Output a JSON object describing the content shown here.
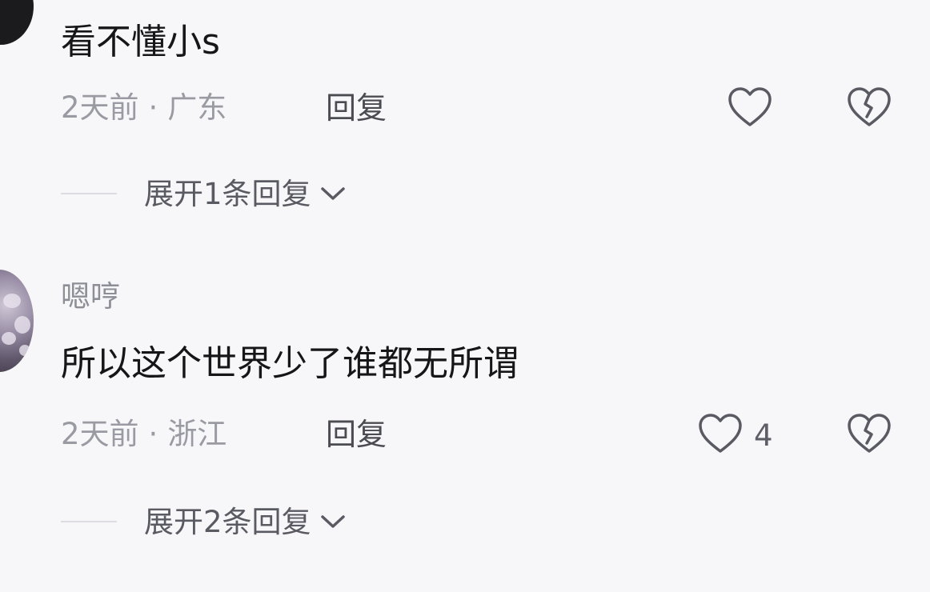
{
  "comments": [
    {
      "username": "",
      "content": "看不懂小s",
      "time": "2天前",
      "location": "广东",
      "reply_label": "回复",
      "like_count": "",
      "expand_label": "展开1条回复",
      "avatar_icon": "user-avatar"
    },
    {
      "username": "嗯哼",
      "content": "所以这个世界少了谁都无所谓",
      "time": "2天前",
      "location": "浙江",
      "reply_label": "回复",
      "like_count": "4",
      "expand_label": "展开2条回复",
      "avatar_icon": "user-avatar"
    }
  ],
  "separator": "·",
  "icons": {
    "like": "heart-outline-icon",
    "dislike": "broken-heart-icon",
    "expand": "chevron-down-icon"
  },
  "colors": {
    "background": "#f7f7fa",
    "text_primary": "#161618",
    "text_secondary": "#9a9aa2",
    "icon_stroke": "#5a5a62"
  }
}
